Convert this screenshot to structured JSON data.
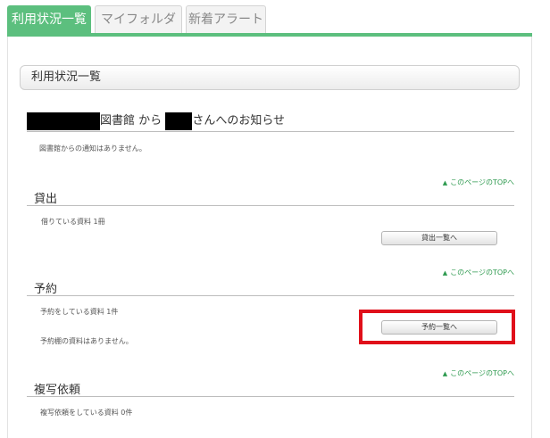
{
  "tabs": [
    {
      "label": "利用状況一覧",
      "active": true
    },
    {
      "label": "マイフォルダ",
      "active": false
    },
    {
      "label": "新着アラート",
      "active": false
    }
  ],
  "header": {
    "title": "利用状況一覧"
  },
  "notice": {
    "title_library": "図書館",
    "title_from": "から",
    "title_suffix": "さんへのお知らせ",
    "message": "図書館からの通知はありません。"
  },
  "page_top_link": "このページのTOPへ",
  "loans": {
    "title": "貸出",
    "count_text": "借りている資料 1冊",
    "button_label": "貸出一覧へ"
  },
  "reservations": {
    "title": "予約",
    "count_text": "予約をしている資料 1件",
    "shelf_text": "予約棚の資料はありません。",
    "button_label": "予約一覧へ"
  },
  "copy_requests": {
    "title": "複写依頼",
    "count_text": "複写依頼をしている資料 0件"
  },
  "colors": {
    "accent_green": "#5cbf7e",
    "link_green": "#2e9a4f",
    "highlight_red": "#e0101a"
  }
}
